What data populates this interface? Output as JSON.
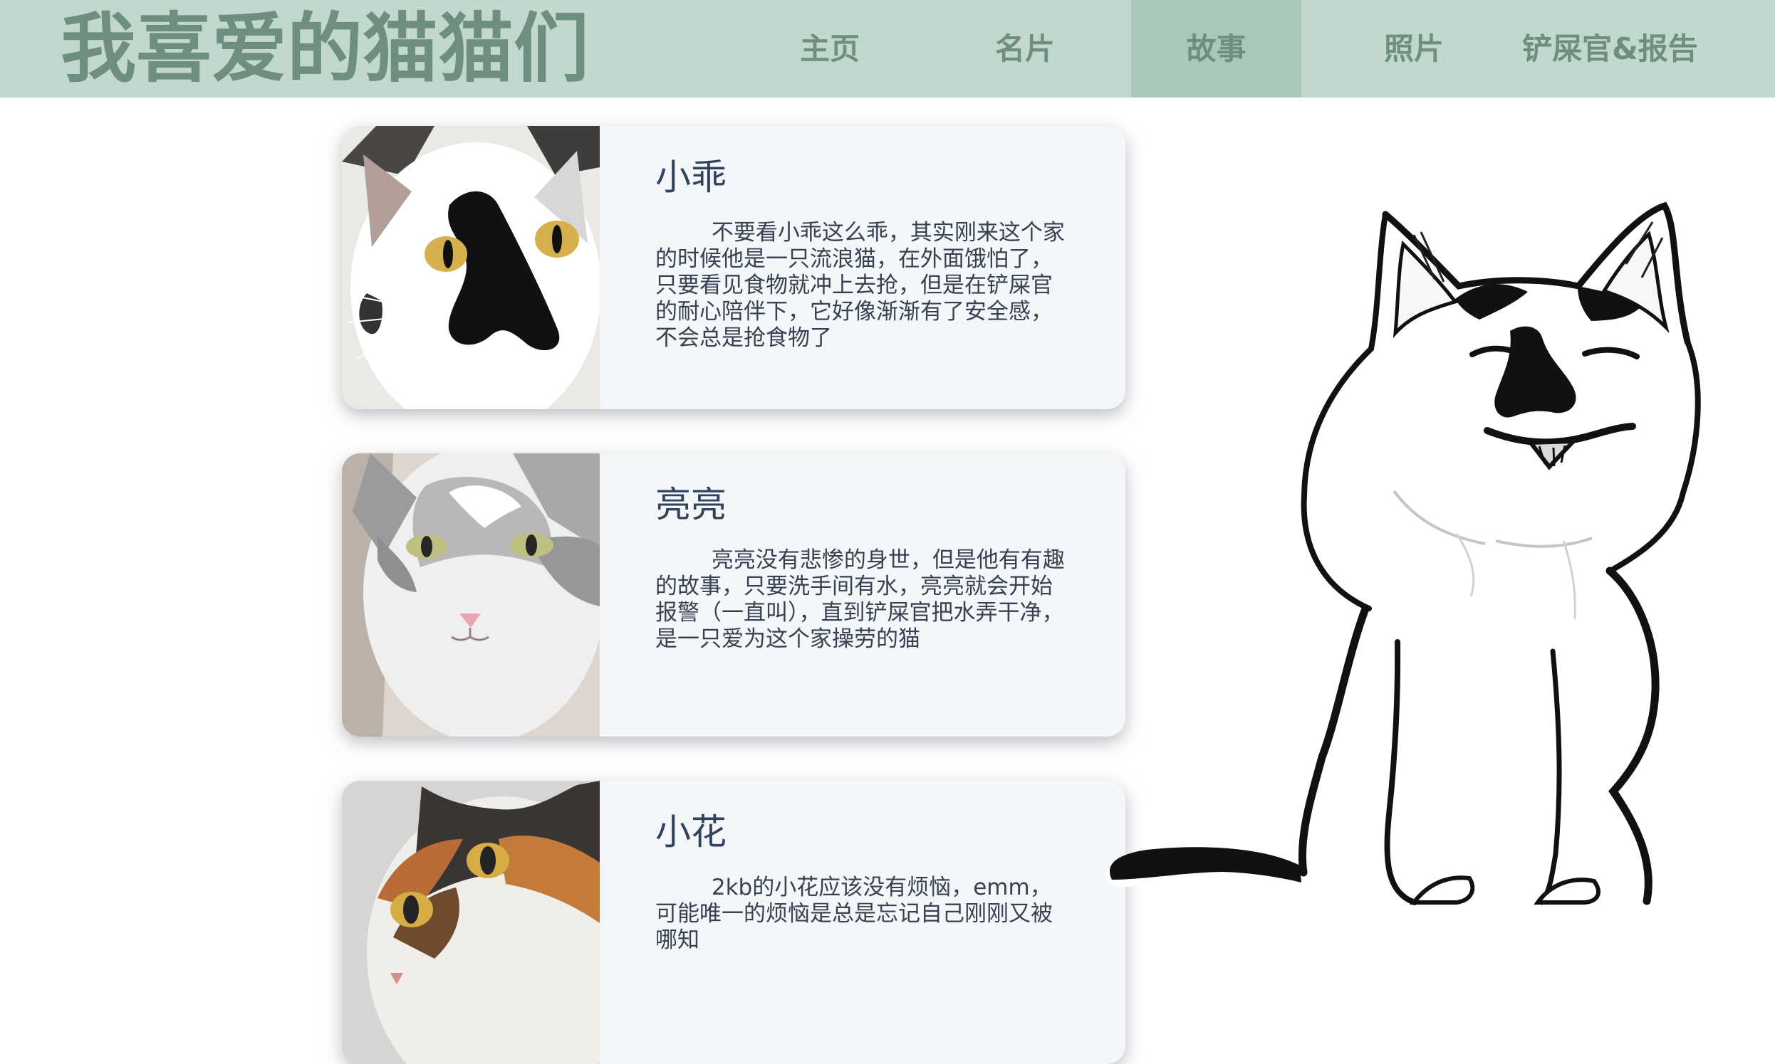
{
  "header": {
    "title": "我喜爱的猫猫们",
    "nav": [
      {
        "label": "主页",
        "active": false
      },
      {
        "label": "名片",
        "active": false
      },
      {
        "label": "故事",
        "active": true
      },
      {
        "label": "照片",
        "active": false
      },
      {
        "label": "铲屎官&报告",
        "active": false
      }
    ]
  },
  "cards": [
    {
      "name": "小乖",
      "text": "        不要看小乖这么乖，其实刚来这个家的时候他是一只流浪猫，在外面饿怕了，只要看见食物就冲上去抢，但是在铲屎官的耐心陪伴下，它好像渐渐有了安全感，不会总是抢食物了",
      "image_icon": "black-white-cat-photo"
    },
    {
      "name": "亮亮",
      "text": "        亮亮没有悲惨的身世，但是他有有趣的故事，只要洗手间有水，亮亮就会开始报警（一直叫），直到铲屎官把水弄干净，是一只爱为这个家操劳的猫",
      "image_icon": "gray-white-cat-photo"
    },
    {
      "name": "小花",
      "text": "        2kb的小花应该没有烦恼，emm，可能唯一的烦恼是总是忘记自己刚刚又被哪知",
      "image_icon": "calico-cat-photo"
    }
  ],
  "illustration": {
    "icon": "smiling-cat-illustration"
  },
  "colors": {
    "header_bg": "#c2d8ce",
    "active_nav_bg": "#a9c8ba",
    "header_text": "#6e8f7d",
    "card_bg": "#f4f7fa",
    "card_title": "#31425a"
  }
}
